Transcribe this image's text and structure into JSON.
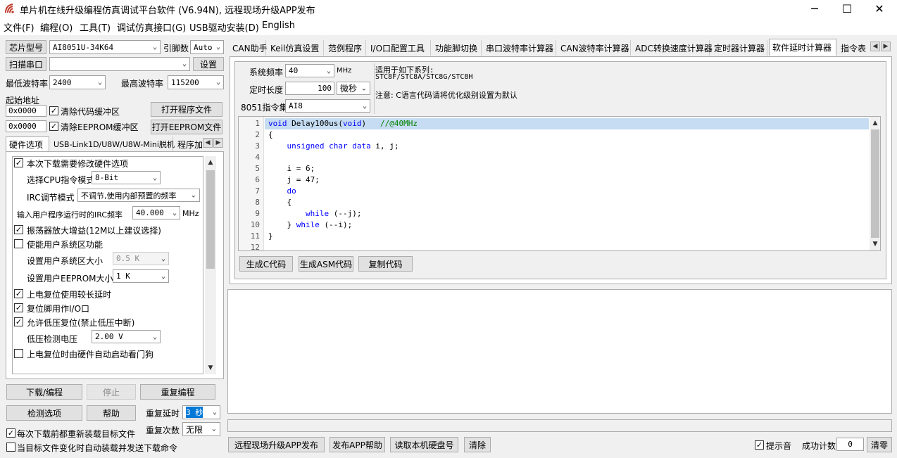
{
  "titlebar": {
    "title": "单片机在线升级编程仿真调试平台软件 (V6.94N), 远程现场升级APP发布",
    "min_label": "─",
    "max_label": "☐",
    "close_label": "✕"
  },
  "menu": [
    "文件(F)",
    "编程(O)",
    "工具(T)",
    "调试仿真接口(G)",
    "USB驱动安装(D)",
    "English"
  ],
  "left": {
    "chip_label": "芯片型号",
    "chip_value": "AI8051U-34K64",
    "pins_label": "引脚数",
    "pins_value": "Auto",
    "scan_port_label": "扫描串口",
    "port_value": "",
    "settings_label": "设置",
    "min_baud_label": "最低波特率",
    "min_baud_value": "2400",
    "max_baud_label": "最高波特率",
    "max_baud_value": "115200",
    "start_addr_label": "起始地址",
    "addr1": "0x0000",
    "clear_code_label": "清除代码缓冲区",
    "open_program_label": "打开程序文件",
    "addr2": "0x0000",
    "clear_eeprom_label": "清除EEPROM缓冲区",
    "open_eeprom_label": "打开EEPROM文件",
    "tabs": [
      "硬件选项",
      "USB-Link1D/U8W/U8W-Mini脱机",
      "程序加"
    ],
    "hw": {
      "need_modify": "本次下载需要修改硬件选项",
      "cpu_mode_label": "选择CPU指令模式",
      "cpu_mode_value": "8-Bit",
      "irc_mode_label": "IRC调节模式",
      "irc_mode_value": "不调节,使用内部预置的频率",
      "irc_freq_label": "输入用户程序运行时的IRC频率",
      "irc_freq_value": "40.000",
      "irc_freq_unit": "MHz",
      "osc_gain": "振荡器放大增益(12M以上建议选择)",
      "enable_sys_area": "使能用户系统区功能",
      "sys_area_size_label": "设置用户系统区大小",
      "sys_area_size_value": "0.5 K",
      "eeprom_size_label": "设置用户EEPROM大小",
      "eeprom_size_value": "1   K",
      "long_reset": "上电复位使用较长延时",
      "reset_pin_io": "复位脚用作I/O口",
      "low_volt_reset": "允许低压复位(禁止低压中断)",
      "low_volt_label": "低压检测电压",
      "low_volt_value": "2.00 V",
      "watchdog": "上电复位时由硬件自动启动看门狗"
    },
    "download_label": "下载/编程",
    "stop_label": "停止",
    "reprogram_label": "重复编程",
    "check_options_label": "检测选项",
    "help_label": "帮助",
    "repeat_delay_label": "重复延时",
    "repeat_delay_value": "3 秒",
    "repeat_count_label": "重复次数",
    "repeat_count_value": "无限",
    "reload_each": "每次下载前都重新装载目标文件",
    "auto_download": "当目标文件变化时自动装载并发送下载命令"
  },
  "right": {
    "tabs": [
      "CAN助手",
      "Keil仿真设置",
      "范例程序",
      "I/O口配置工具",
      "功能脚切换",
      "串口波特率计算器",
      "CAN波特率计算器",
      "ADC转换速度计算器",
      "定时器计算器",
      "软件延时计算器",
      "指令表"
    ],
    "sys_freq_label": "系统频率",
    "sys_freq_value": "40",
    "sys_freq_unit": "MHz",
    "delay_len_label": "定时长度",
    "delay_len_value": "100",
    "delay_unit_value": "微秒",
    "instr_set_label": "8051指令集",
    "instr_set_value": "AI8",
    "applies_label": "适用于如下系列:",
    "applies_series": "STC8F/STC8A/STC8G/STC8H",
    "note_label": "注意: C语言代码请将优化级别设置为默认",
    "code_lines": [
      {
        "n": "1",
        "t": "void Delay100us(void)   //@40MHz"
      },
      {
        "n": "2",
        "t": "{"
      },
      {
        "n": "3",
        "t": "    unsigned char data i, j;"
      },
      {
        "n": "4",
        "t": ""
      },
      {
        "n": "5",
        "t": "    i = 6;"
      },
      {
        "n": "6",
        "t": "    j = 47;"
      },
      {
        "n": "7",
        "t": "    do"
      },
      {
        "n": "8",
        "t": "    {"
      },
      {
        "n": "9",
        "t": "        while (--j);"
      },
      {
        "n": "10",
        "t": "    } while (--i);"
      },
      {
        "n": "11",
        "t": "}"
      },
      {
        "n": "12",
        "t": ""
      }
    ],
    "gen_c_label": "生成C代码",
    "gen_asm_label": "生成ASM代码",
    "copy_code_label": "复制代码"
  },
  "bottom": {
    "remote_publish_label": "远程现场升级APP发布",
    "publish_help_label": "发布APP帮助",
    "read_disk_label": "读取本机硬盘号",
    "clear_label": "清除",
    "beep_label": "提示音",
    "success_count_label": "成功计数",
    "success_count_value": "0",
    "reset_label": "清零"
  }
}
